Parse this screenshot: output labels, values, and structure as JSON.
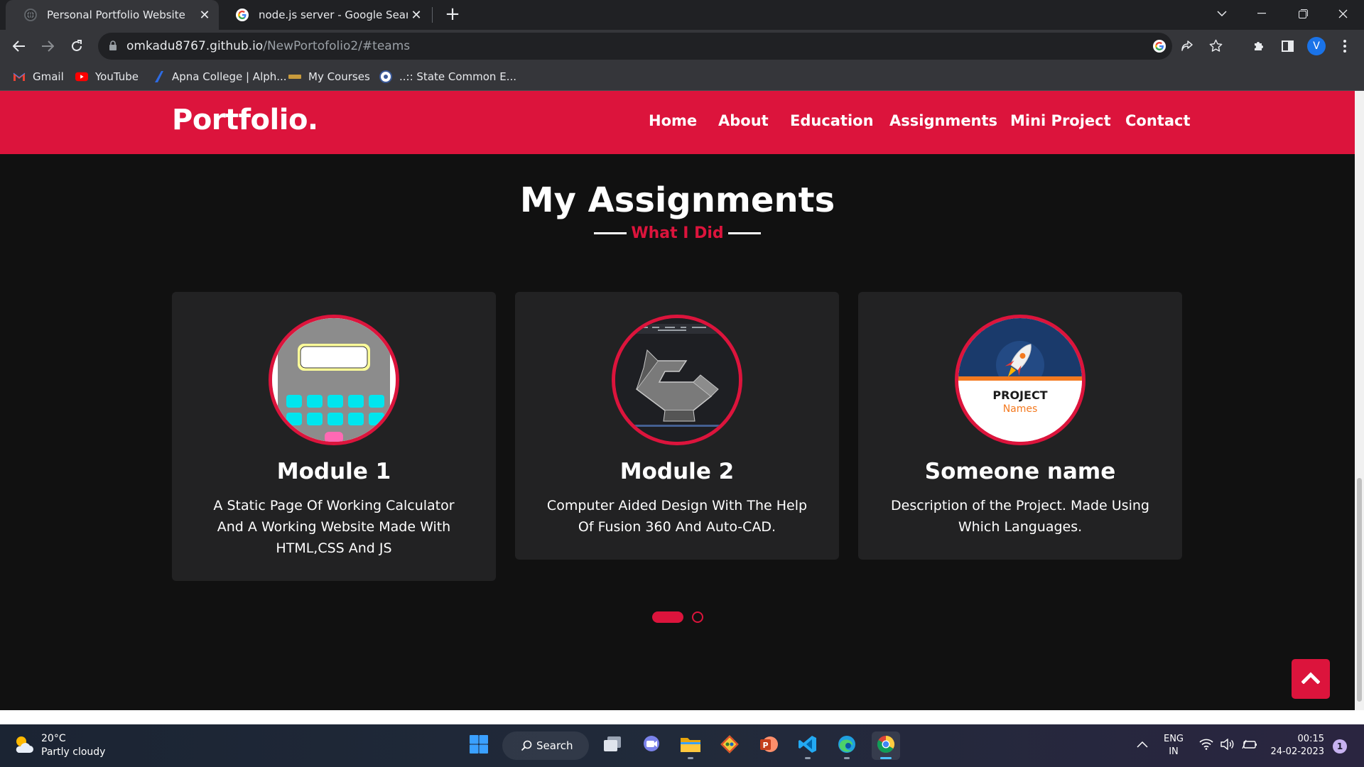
{
  "browser": {
    "tabs": [
      {
        "title": "Personal Portfolio Website",
        "active": true
      },
      {
        "title": "node.js server - Google Search",
        "active": false
      }
    ],
    "url_domain": "omkadu8767.github.io",
    "url_path": "/NewPortofolio2/#teams",
    "profile_initial": "V",
    "bookmarks": [
      {
        "label": "Gmail",
        "icon": "gmail-icon"
      },
      {
        "label": "YouTube",
        "icon": "youtube-icon"
      },
      {
        "label": "Apna College | Alph...",
        "icon": "apna-college-icon"
      },
      {
        "label": "My Courses",
        "icon": "courses-icon"
      },
      {
        "label": "..:: State Common E...",
        "icon": "cet-icon"
      }
    ]
  },
  "site": {
    "brand": "Portfolio.",
    "nav": [
      "Home",
      "About",
      "Education",
      "Assignments",
      "Mini Project",
      "Contact"
    ],
    "section_title": "My Assignments",
    "section_subtitle": "What I Did",
    "cards": [
      {
        "title": "Module 1",
        "description": "A Static Page Of Working Calculator And A Working Website Made With HTML,CSS And JS",
        "image": "calculator-image"
      },
      {
        "title": "Module 2",
        "description": "Computer Aided Design With The Help Of Fusion 360 And Auto-CAD.",
        "image": "cad-model-image"
      },
      {
        "title": "Someone name",
        "description": "Description of the Project. Made Using Which Languages.",
        "image": "project-names-image",
        "image_text_1": "PROJECT",
        "image_text_2": "Names"
      }
    ],
    "carousel": {
      "pages": 2,
      "active_page": 1
    }
  },
  "taskbar": {
    "weather_temp": "20°C",
    "weather_desc": "Partly cloudy",
    "search_label": "Search",
    "lang_1": "ENG",
    "lang_2": "IN",
    "time": "00:15",
    "date": "24-02-2023",
    "notification_count": "1"
  },
  "colors": {
    "accent": "#dc143c",
    "page_bg": "#111111",
    "card_bg": "#222223"
  }
}
